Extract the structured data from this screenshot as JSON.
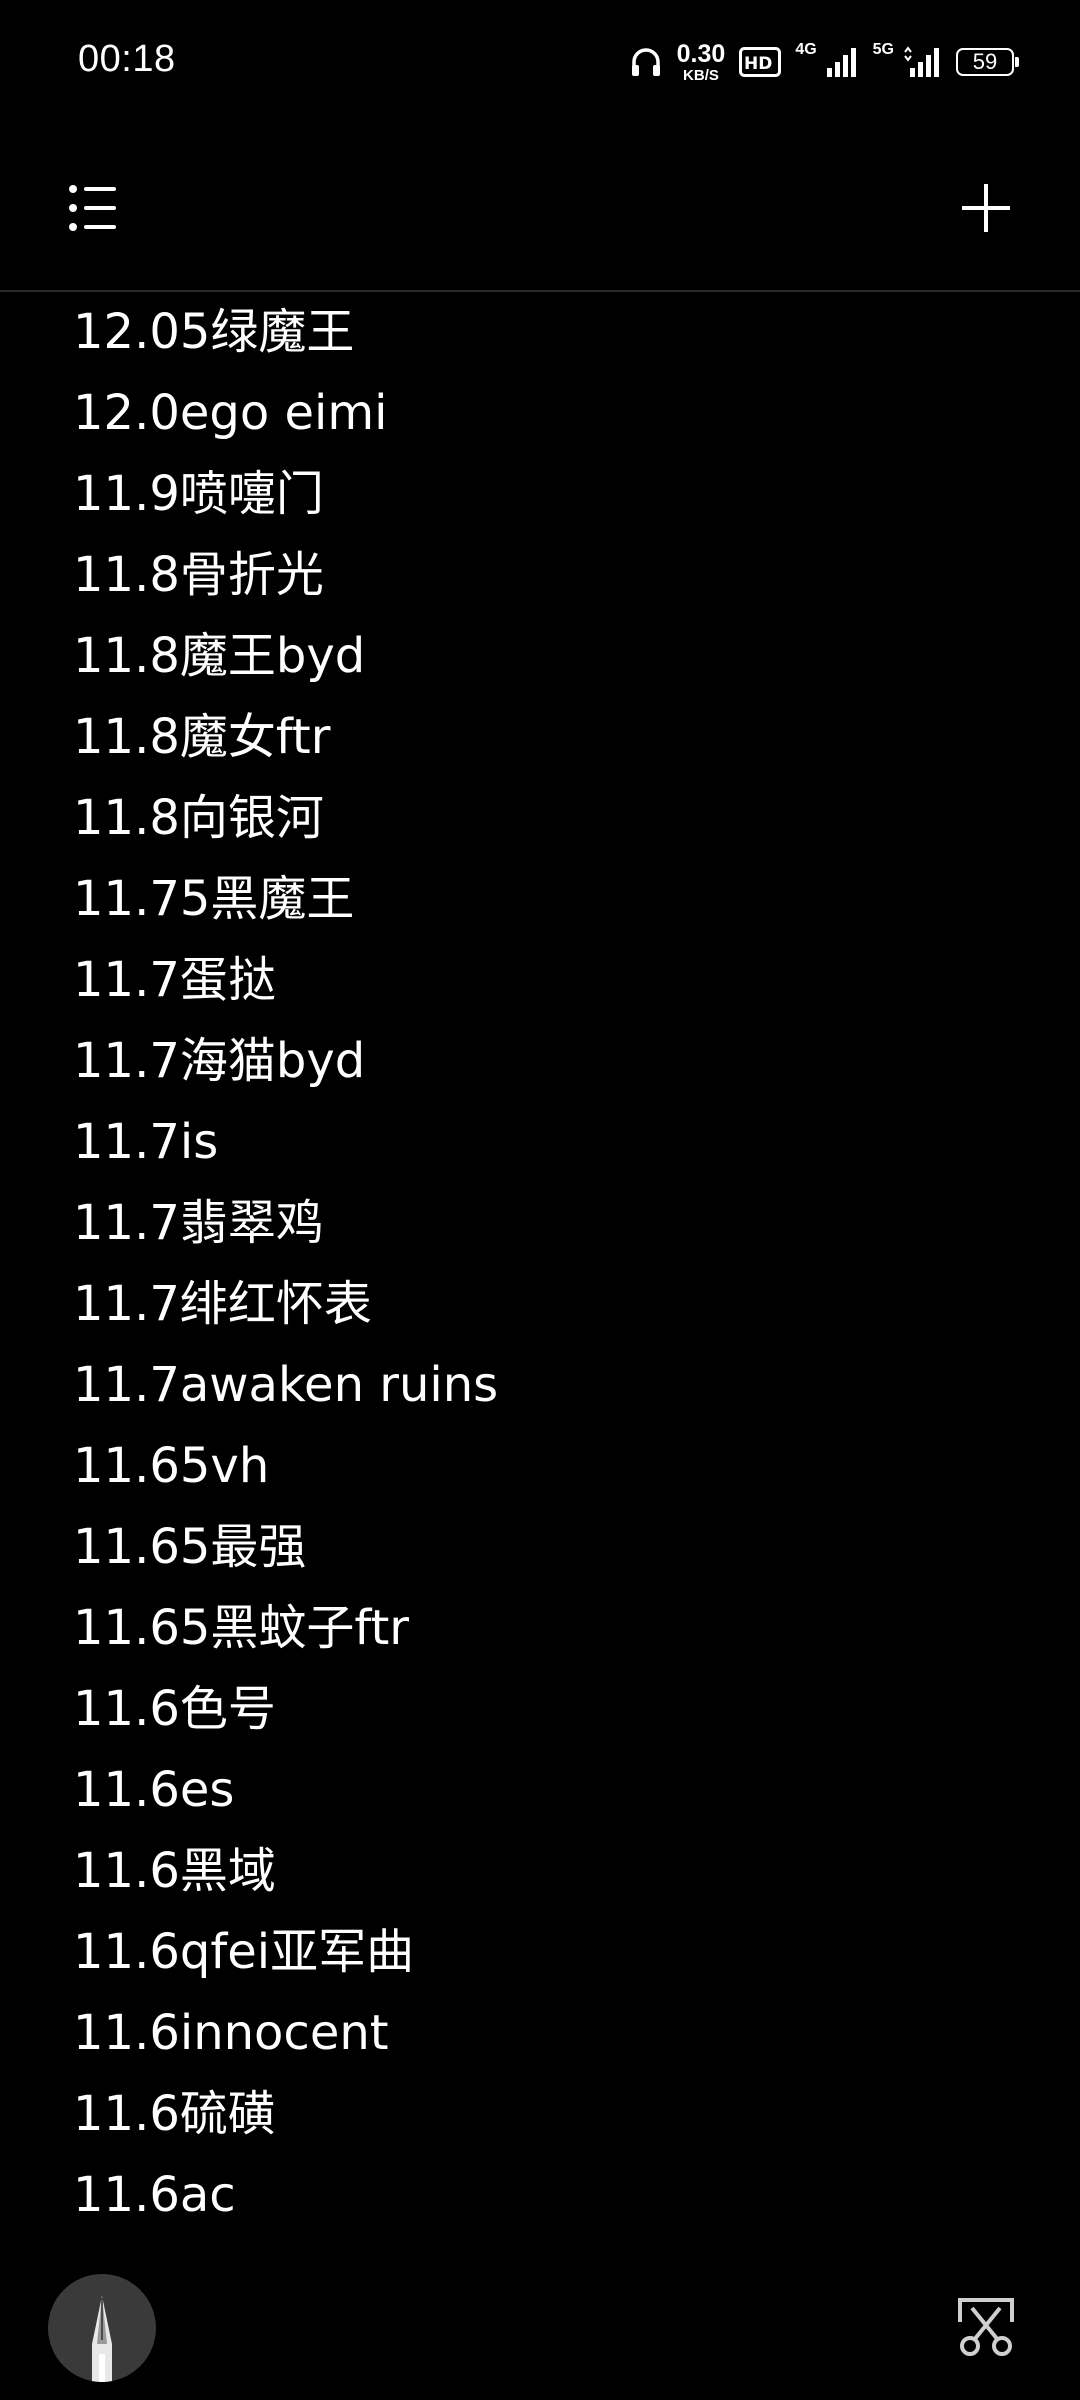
{
  "status_bar": {
    "time": "00:18",
    "net_speed_value": "0.30",
    "net_speed_unit": "KB/S",
    "hd_badge": "HD",
    "signal_1_label": "4G",
    "signal_2_label": "5G",
    "battery_level": "59"
  },
  "app_bar": {
    "menu_icon": "menu-list-icon",
    "add_icon": "plus-icon"
  },
  "items": [
    "12.05绿魔王",
    "12.0ego eimi",
    "11.9喷嚏门",
    "11.8骨折光",
    "11.8魔王byd",
    "11.8魔女ftr",
    "11.8向银河",
    "11.75黑魔王",
    "11.7蛋挞",
    "11.7海猫byd",
    "11.7is",
    "11.7翡翠鸡",
    "11.7绯红怀表",
    "11.7awaken ruins",
    "11.65vh",
    "11.65最强",
    "11.65黑蚊子ftr",
    "11.6色号",
    "11.6es",
    "11.6黑域",
    "11.6qfei亚军曲",
    "11.6innocent",
    "11.6硫磺",
    "11.6ac"
  ],
  "fabs": {
    "pen_icon": "pen-icon",
    "scissor_icon": "scissor-icon"
  }
}
